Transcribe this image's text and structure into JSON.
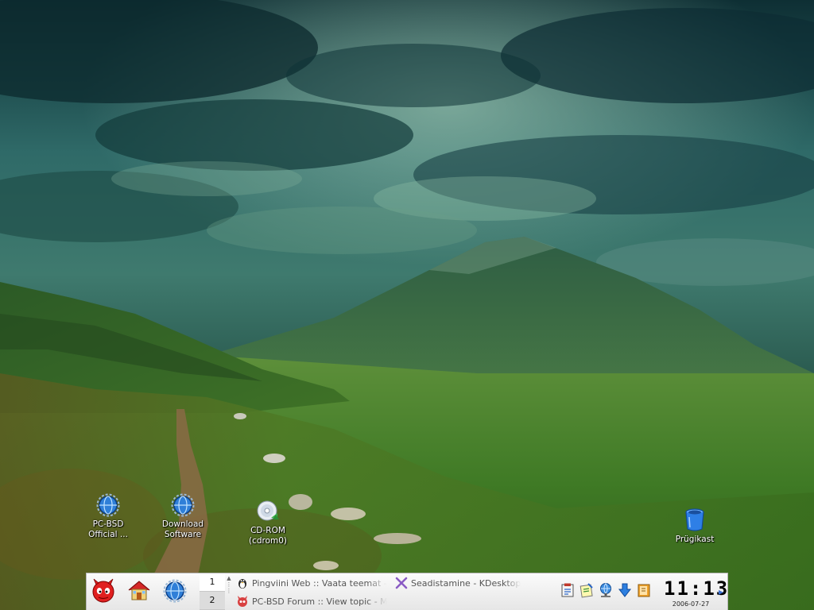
{
  "desktop": {
    "icons": [
      {
        "id": "pcbsd-official",
        "label_line1": "PC-BSD",
        "label_line2": "Official ...",
        "icon": "globe-gear-icon"
      },
      {
        "id": "download-software",
        "label_line1": "Download",
        "label_line2": "Software",
        "icon": "globe-gear-icon"
      },
      {
        "id": "cdrom",
        "label_line1": "CD-ROM",
        "label_line2": "(cdrom0)",
        "icon": "cdrom-icon"
      },
      {
        "id": "trash",
        "label_line1": "Prügikast",
        "label_line2": "",
        "icon": "trash-icon"
      }
    ]
  },
  "panel": {
    "launchers": [
      {
        "name": "pcbsd-menu",
        "icon": "beastie-icon"
      },
      {
        "name": "home",
        "icon": "home-icon"
      },
      {
        "name": "browser",
        "icon": "globe-gear-icon"
      }
    ],
    "pager": {
      "desktops": [
        "1",
        "2"
      ],
      "active": "1"
    },
    "tasks": [
      {
        "label": "Pingviini Web :: Vaata teemat - T",
        "icon": "tux-icon"
      },
      {
        "label": "Seadistamine - KDesktop",
        "icon": "kde-x-icon"
      },
      {
        "label": "PC-BSD Forum :: View topic - My",
        "icon": "beastie-icon"
      }
    ],
    "tray": [
      {
        "name": "tray-klipper",
        "icon": "clipboard-icon"
      },
      {
        "name": "tray-notes",
        "icon": "notes-icon"
      },
      {
        "name": "tray-network",
        "icon": "network-icon"
      },
      {
        "name": "tray-update",
        "icon": "download-arrow-icon"
      },
      {
        "name": "tray-book",
        "icon": "book-icon"
      }
    ],
    "clock": {
      "time": "11:13",
      "date": "2006-07-27"
    }
  },
  "colors": {
    "panel_bg": "#f2f2f2",
    "icon_label": "#ffffff",
    "hide_arrow": "#3a6fd0"
  }
}
